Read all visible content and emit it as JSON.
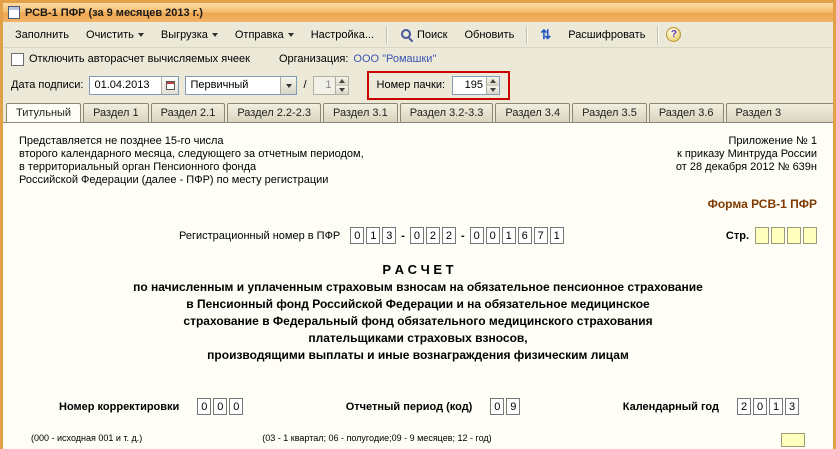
{
  "window": {
    "title": "РСВ-1 ПФР (за 9 месяцев 2013 г.)"
  },
  "toolbar": {
    "fill": "Заполнить",
    "clear": "Очистить",
    "export": "Выгрузка",
    "send": "Отправка",
    "settings": "Настройка...",
    "search": "Поиск",
    "refresh": "Обновить",
    "explain": "Расшифровать",
    "exchange_glyph": "⇅",
    "help_glyph": "?"
  },
  "options": {
    "autocalc_label": "Отключить авторасчет вычисляемых ячеек",
    "org_label": "Организация:",
    "org_value": "ООО \"Ромашки\""
  },
  "params": {
    "date_label": "Дата подписи:",
    "date_value": "01.04.2013",
    "kind_value": "Первичный",
    "slash": "/",
    "rev_value": "1",
    "pack_label": "Номер пачки:",
    "pack_value": "195"
  },
  "tabs": [
    "Титульный",
    "Раздел 1",
    "Раздел 2.1",
    "Раздел 2.2-2.3",
    "Раздел 3.1",
    "Раздел 3.2-3.3",
    "Раздел 3.4",
    "Раздел 3.5",
    "Раздел 3.6",
    "Раздел 3"
  ],
  "form": {
    "left_note": [
      "Представляется не позднее 15-го числа",
      "второго календарного месяца, следующего за отчетным периодом,",
      "в территориальный орган Пенсионного фонда",
      "Российской Федерации (далее - ПФР) по месту регистрации"
    ],
    "right_note": [
      "Приложение № 1",
      "к приказу Минтруда России",
      "от 28 декабря 2012 № 639н"
    ],
    "form_name": "Форма РСВ-1 ПФР",
    "reg_label": "Регистрационный номер в ПФР",
    "dash": "-",
    "reg_groups": [
      [
        "0",
        "1",
        "3"
      ],
      [
        "0",
        "2",
        "2"
      ],
      [
        "0",
        "0",
        "1",
        "6",
        "7",
        "1"
      ]
    ],
    "page_label": "Стр.",
    "calc_title": "Р А С Ч Е Т",
    "calc_lines": [
      "по начисленным и уплаченным страховым взносам на обязательное пенсионное страхование",
      "в Пенсионный фонд Российской Федерации и на обязательное медицинское",
      "страхование в Федеральный фонд обязательного медицинского страхования",
      "плательщиками страховых взносов,",
      "производящими выплаты и иные вознаграждения физическим лицам"
    ],
    "correction_label": "Номер корректировки",
    "correction_digits": [
      "0",
      "0",
      "0"
    ],
    "period_label": "Отчетный период (код)",
    "period_digits": [
      "0",
      "9"
    ],
    "year_label": "Календарный год",
    "year_digits": [
      "2",
      "0",
      "1",
      "3"
    ],
    "footnote_left": "(000 - исходная 001 и т. д.)",
    "footnote_mid": "(03 - 1 квартал; 06 - полугодие;09 - 9 месяцев; 12 - год)"
  },
  "colors": {
    "highlight": "#cc0000",
    "link_blue": "#3b56b0",
    "form_name_brown": "#7f3a00",
    "cell_yellow": "#ffffbe"
  }
}
